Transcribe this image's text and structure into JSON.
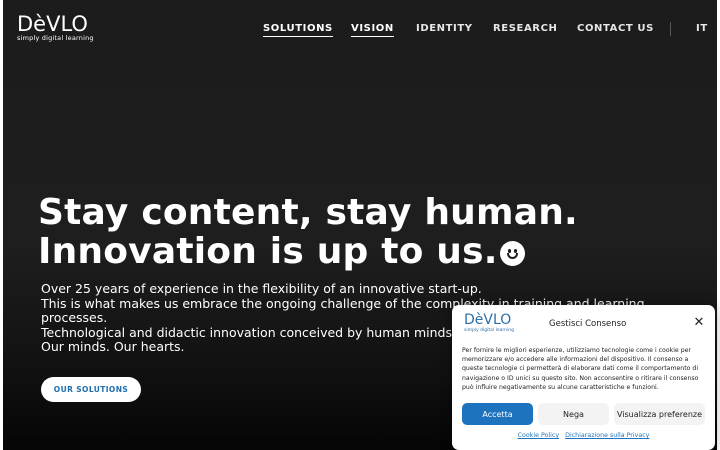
{
  "brand": {
    "logo_text": "DèVLO",
    "tagline": "simply digital learning",
    "accent": "#c9444c",
    "link_blue": "#1e73be"
  },
  "nav": {
    "items": [
      {
        "label": "SOLUTIONS"
      },
      {
        "label": "VISION"
      },
      {
        "label": "IDENTITY"
      },
      {
        "label": "RESEARCH"
      },
      {
        "label": "CONTACT US"
      }
    ],
    "language": "IT"
  },
  "hero": {
    "title_line1_pre": "Stay ",
    "title_line1_highlight": "content",
    "title_line1_post": ", stay human.",
    "title_line2": "Innovation is up to us.",
    "emoji_icon": "smiley-face-icon",
    "body_lines": [
      "Over 25 years of experience in the flexibility of an innovative start-up.",
      "This is what makes us embrace the ongoing challenge of the complexity in training and learning",
      "processes.",
      "Technological and didactic innovation conceived by human minds and",
      "Our minds. Our hearts."
    ],
    "cta_label": "OUR SOLUTIONS"
  },
  "consent": {
    "title": "Gestisci Consenso",
    "close_icon": "close-icon",
    "text": "Per fornire le migliori esperienze, utilizziamo tecnologie come i cookie per memorizzare e/o accedere alle informazioni del dispositivo. Il consenso a queste tecnologie ci permetterà di elaborare dati come il comportamento di navigazione o ID unici su questo sito. Non acconsentire o ritirare il consenso può influire negativamente su alcune caratteristiche e funzioni.",
    "accept_label": "Accetta",
    "deny_label": "Nega",
    "prefs_label": "Visualizza preferenze",
    "links": [
      {
        "label": "Cookie Policy"
      },
      {
        "label": "Dichiarazione sulla Privacy"
      }
    ]
  }
}
